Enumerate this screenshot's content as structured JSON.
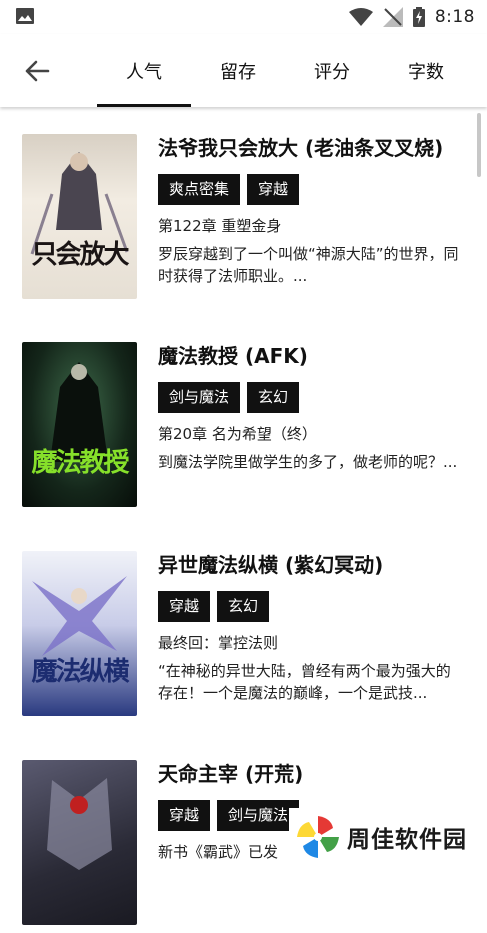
{
  "status_bar": {
    "time": "8:18",
    "icons": [
      "image-icon",
      "wifi-icon",
      "no-signal-icon",
      "battery-charging-icon"
    ]
  },
  "app_bar": {
    "back_icon": "arrow-left-icon",
    "tabs": [
      {
        "label": "人气",
        "active": true
      },
      {
        "label": "留存",
        "active": false
      },
      {
        "label": "评分",
        "active": false
      },
      {
        "label": "字数",
        "active": false
      }
    ]
  },
  "books": [
    {
      "title": "法爷我只会放大 (老油条叉叉烧)",
      "tags": [
        "爽点密集",
        "穿越"
      ],
      "chapter": "第122章 重塑金身",
      "description": "罗辰穿越到了一个叫做“神源大陆”的世界，同时获得了法师职业。...",
      "cover": {
        "text": "只会放大",
        "colors": [
          "#e8e0d0",
          "#5a5060",
          "#b03020"
        ]
      }
    },
    {
      "title": "魔法教授 (AFK)",
      "tags": [
        "剑与魔法",
        "玄幻"
      ],
      "chapter": "第20章 名为希望（终）",
      "description": "到魔法学院里做学生的多了，做老师的呢？...",
      "cover": {
        "text": "魔法教授",
        "colors": [
          "#0e1a12",
          "#2e5a3a",
          "#7fdc2a"
        ]
      }
    },
    {
      "title": "异世魔法纵横 (紫幻冥动)",
      "tags": [
        "穿越",
        "玄幻"
      ],
      "chapter": "最终回：掌控法则",
      "description": "“在神秘的异世大陆，曾经有两个最为强大的存在！一个是魔法的巅峰，一个是武技...",
      "cover": {
        "text": "魔法纵横",
        "colors": [
          "#dfe6f2",
          "#6a6ab0",
          "#1c2c70"
        ]
      }
    },
    {
      "title": "天命主宰 (开荒)",
      "tags": [
        "穿越",
        "剑与魔法"
      ],
      "chapter": "新书《霸武》已发",
      "description": "",
      "cover": {
        "text": "",
        "colors": [
          "#3a3a48",
          "#8a8aa0",
          "#c02020"
        ]
      }
    }
  ],
  "watermark": {
    "text": "周佳软件园"
  }
}
